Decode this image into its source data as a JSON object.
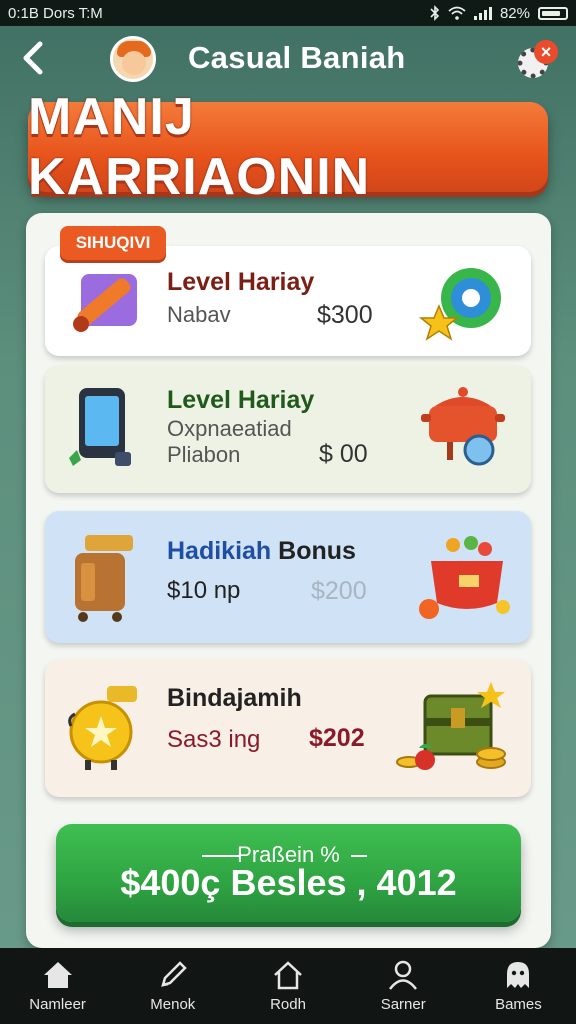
{
  "status_bar": {
    "left_text": "0:1B Dors T:M",
    "battery_text": "82%"
  },
  "header": {
    "title": "Casual Baniah"
  },
  "banner": {
    "title": "MANIJ KARRIAONIN"
  },
  "section": {
    "tag": "SIHUQIVI"
  },
  "cards": [
    {
      "title": "Level Hariay",
      "subtitle": "Nabav",
      "price": "$300",
      "title_color": "#7a1f16"
    },
    {
      "title": "Level Hariay",
      "subtitle": "Oxpnaeatiad",
      "subtitle2": "Pliabon",
      "price": "$ 00",
      "title_color": "#1f5a1c"
    },
    {
      "title_blue": "Hadikiah",
      "title_dark": "Bonus",
      "subtitle": "$10 np",
      "price": "$200"
    },
    {
      "title": "Bindajamih",
      "subtitle": "Sas3 ing",
      "price": "$202",
      "price_color": "#8a1a2a"
    }
  ],
  "reward_button": {
    "top_label": "Praßein %",
    "main_label": "$400ç Besles , 4012"
  },
  "bottom_nav": {
    "items": [
      {
        "label": "Namleer",
        "icon": "home-icon"
      },
      {
        "label": "Menok",
        "icon": "pencil-icon"
      },
      {
        "label": "Rodh",
        "icon": "house-outline-icon"
      },
      {
        "label": "Sarner",
        "icon": "person-icon"
      },
      {
        "label": "Bames",
        "icon": "ghost-icon"
      }
    ]
  },
  "colors": {
    "banner": "#e7541c",
    "reward": "#2fa442",
    "panel": "#f4f6f2"
  }
}
